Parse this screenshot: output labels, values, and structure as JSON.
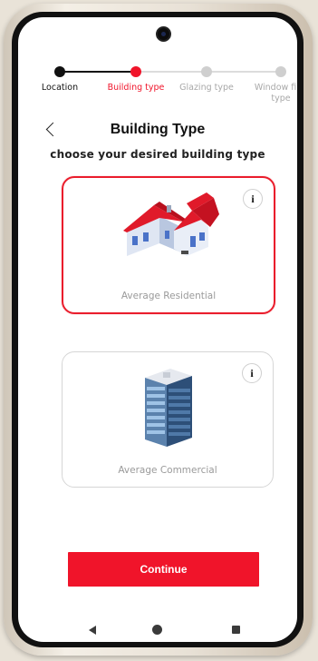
{
  "stepper": {
    "steps": [
      {
        "label": "Location",
        "state": "done"
      },
      {
        "label": "Building type",
        "state": "active"
      },
      {
        "label": "Glazing type",
        "state": "todo"
      },
      {
        "label": "Window film\ntype",
        "state": "todo"
      }
    ]
  },
  "header": {
    "title": "Building Type",
    "subtitle": "choose your desired building type",
    "back_icon": "chevron-left-icon"
  },
  "options": [
    {
      "label": "Average Residential",
      "selected": true,
      "info": "i"
    },
    {
      "label": "Average Commercial",
      "selected": false,
      "info": "i"
    }
  ],
  "actions": {
    "continue_label": "Continue"
  },
  "colors": {
    "accent": "#f0142a",
    "done": "#111111",
    "todo": "#cfcfcf"
  },
  "navigation": [
    "back-icon",
    "home-icon",
    "recents-icon"
  ]
}
